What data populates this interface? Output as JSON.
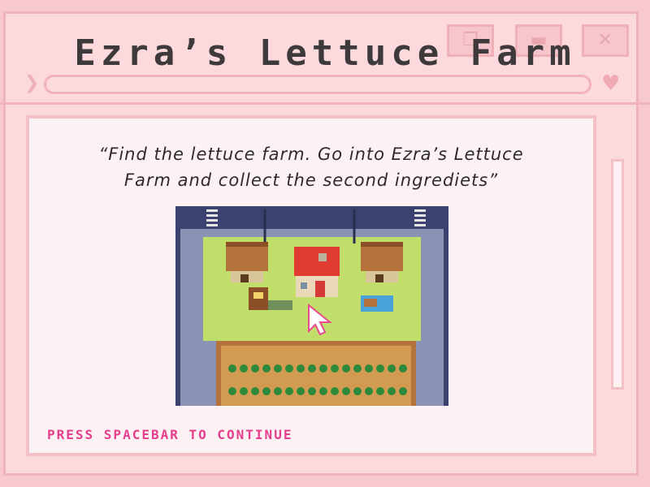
{
  "window": {
    "title": "Ezra’s Lettuce Farm",
    "buttons": [
      {
        "name": "restore-button",
        "icon": "restore-icon",
        "glyph": "❐"
      },
      {
        "name": "minimize-button",
        "icon": "minimize-icon",
        "glyph": "▬"
      },
      {
        "name": "close-button",
        "icon": "close-icon",
        "glyph": "✕"
      }
    ],
    "nav_glyph": "❯",
    "heart_glyph": "♥"
  },
  "dialog": {
    "quote": "“Find the lettuce farm. Go into Ezra’s Lettuce Farm and collect the second ingrediets”",
    "prompt": "PRESS SPACEBAR TO CONTINUE"
  },
  "colors": {
    "background": "#f7c9cf",
    "prompt": "#e53e8d",
    "grass": "#c2de6a",
    "road": "#3b4270",
    "roof_red": "#e23b32",
    "wood": "#b5733c",
    "soil": "#d39b52",
    "lettuce": "#2c8a3a"
  },
  "map": {
    "icons": [
      "barn-icon",
      "house-icon",
      "barn-icon",
      "market-stall-icon",
      "cart-icon",
      "pointer-cursor-icon",
      "lettuce-field-icon"
    ]
  }
}
